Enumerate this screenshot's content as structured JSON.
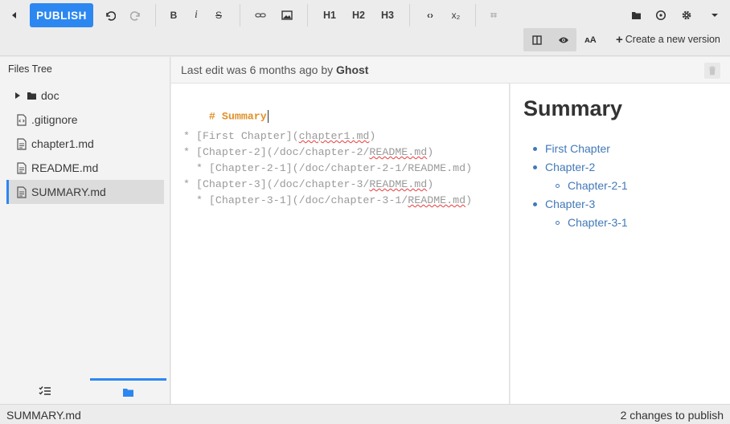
{
  "toolbar": {
    "publish_label": "PUBLISH",
    "h1": "H1",
    "h2": "H2",
    "h3": "H3",
    "bold": "B",
    "italic": "i",
    "strike": "S",
    "code": "‹›",
    "subscript": "x₂",
    "new_version_label": "Create a new version"
  },
  "sidebar": {
    "title": "Files Tree",
    "items": [
      {
        "label": "doc",
        "icon": "folder-icon"
      },
      {
        "label": ".gitignore",
        "icon": "file-code-icon"
      },
      {
        "label": "chapter1.md",
        "icon": "file-icon"
      },
      {
        "label": "README.md",
        "icon": "file-icon"
      },
      {
        "label": "SUMMARY.md",
        "icon": "file-icon"
      }
    ]
  },
  "info": {
    "prefix": "Last edit was 6 months ago by",
    "author": "Ghost"
  },
  "editor": {
    "heading": "# Summary",
    "l1a": "* [First Chapter](",
    "l1b": "chapter1.md",
    "l1c": ")",
    "l2a": "* [Chapter-2](/doc/chapter-2/",
    "l2b": "README.md",
    "l2c": ")",
    "l3": "  * [Chapter-2-1](/doc/chapter-2-1/README.md)",
    "l4a": "* [Chapter-3](/doc/chapter-3/",
    "l4b": "README.md",
    "l4c": ")",
    "l5a": "  * [Chapter-3-1](/doc/chapter-3-1/",
    "l5b": "README.md",
    "l5c": ")"
  },
  "preview": {
    "title": "Summary",
    "items": [
      "First Chapter",
      "Chapter-2",
      "Chapter-2-1",
      "Chapter-3",
      "Chapter-3-1"
    ]
  },
  "status": {
    "file": "SUMMARY.md",
    "changes": "2 changes to publish"
  },
  "colors": {
    "accent": "#2c87f0",
    "link": "#4279b8",
    "heading_markdown": "#e0912b"
  }
}
